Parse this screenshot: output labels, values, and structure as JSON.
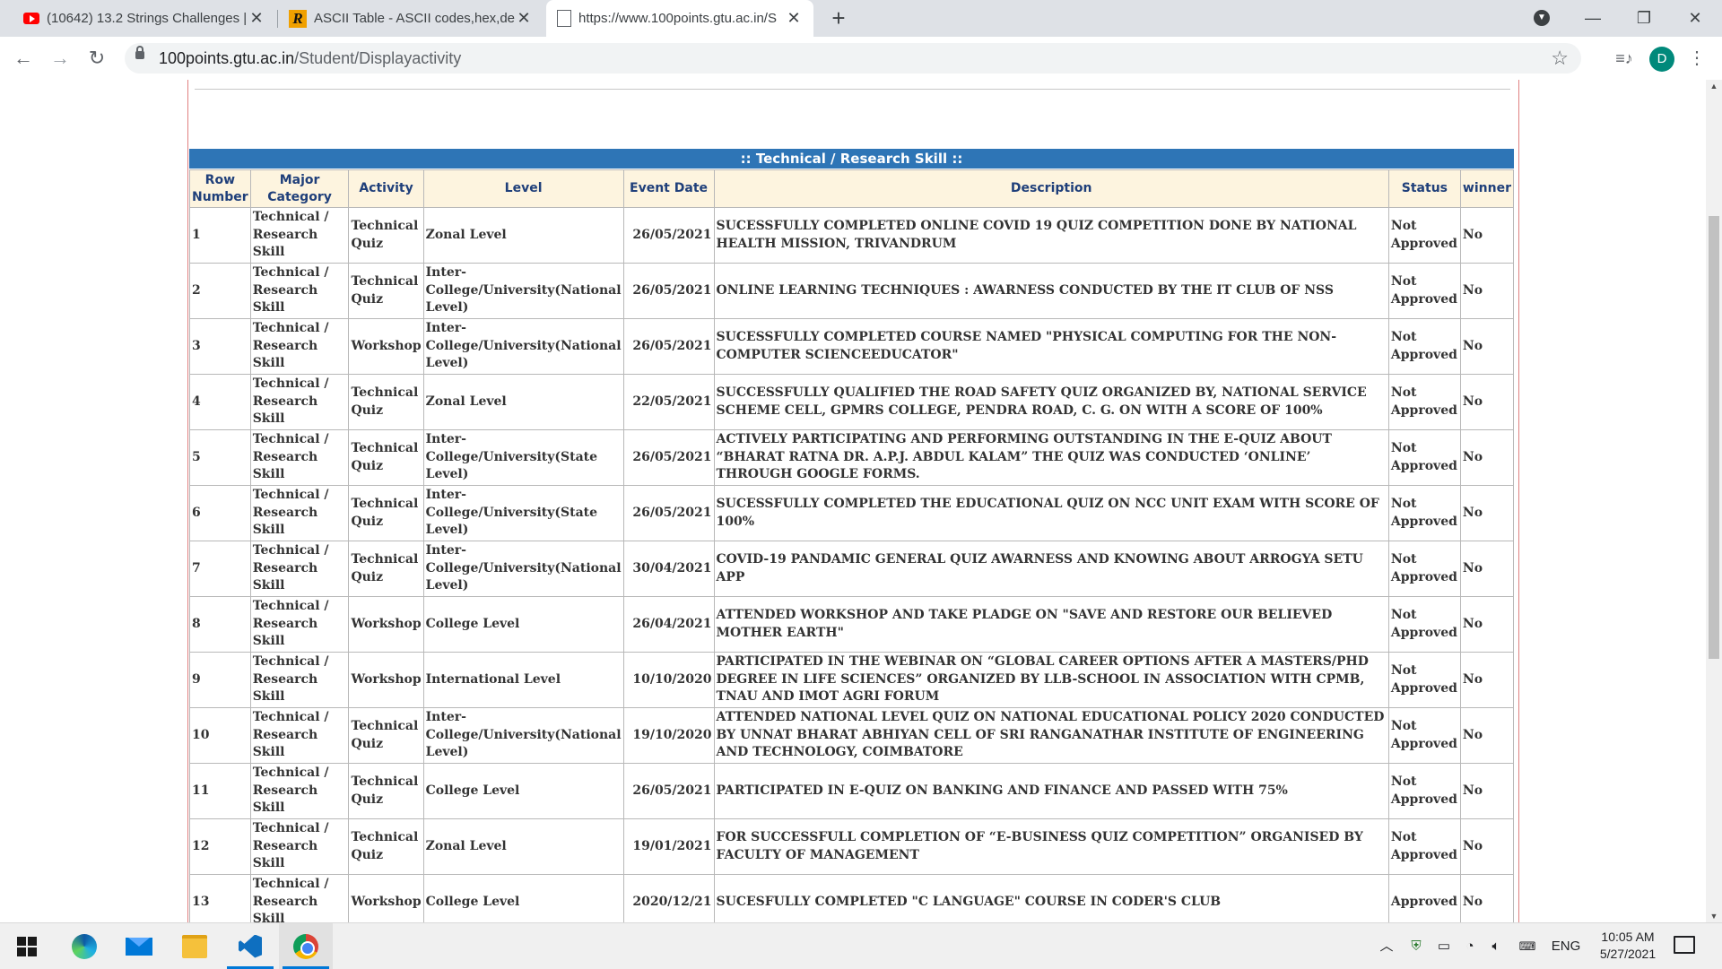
{
  "browser": {
    "tabs": [
      {
        "title": "(10642) 13.2 Strings Challenges |",
        "favicon": "youtube-icon"
      },
      {
        "title": "ASCII Table - ASCII codes,hex,dec",
        "favicon": "r-logo-icon"
      },
      {
        "title": "https://www.100points.gtu.ac.in/S",
        "favicon": "document-icon"
      }
    ],
    "url_domain": "100points.gtu.ac.in",
    "url_path": "/Student/Displayactivity",
    "profile_initial": "D"
  },
  "page": {
    "section_title": ":: Technical / Research Skill ::",
    "columns": [
      "Row Number",
      "Major Category",
      "Activity",
      "Level",
      "Event Date",
      "Description",
      "Status",
      "winner"
    ],
    "rows": [
      {
        "no": "1",
        "category": "Technical / Research Skill",
        "activity": "Technical Quiz",
        "level": "Zonal Level",
        "date": "26/05/2021",
        "description": "SUCESSFULLY COMPLETED ONLINE COVID 19 QUIZ COMPETITION DONE BY NATIONAL HEALTH MISSION, TRIVANDRUM",
        "status": "Not Approved",
        "winner": "No"
      },
      {
        "no": "2",
        "category": "Technical / Research Skill",
        "activity": "Technical Quiz",
        "level": "Inter-College/University(National Level)",
        "date": "26/05/2021",
        "description": "ONLINE LEARNING TECHNIQUES : AWARNESS CONDUCTED BY THE IT CLUB OF NSS",
        "status": "Not Approved",
        "winner": "No"
      },
      {
        "no": "3",
        "category": "Technical / Research Skill",
        "activity": "Workshop",
        "level": "Inter-College/University(National Level)",
        "date": "26/05/2021",
        "description": "SUCESSFULLY COMPLETED COURSE NAMED \"PHYSICAL COMPUTING FOR THE NON-COMPUTER SCIENCEEDUCATOR\"",
        "status": "Not Approved",
        "winner": "No"
      },
      {
        "no": "4",
        "category": "Technical / Research Skill",
        "activity": "Technical Quiz",
        "level": "Zonal Level",
        "date": "22/05/2021",
        "description": "SUCCESSFULLY QUALIFIED THE ROAD SAFETY QUIZ ORGANIZED BY, NATIONAL SERVICE SCHEME CELL, GPMRS COLLEGE, PENDRA ROAD, C. G. ON WITH A SCORE OF 100%",
        "status": "Not Approved",
        "winner": "No"
      },
      {
        "no": "5",
        "category": "Technical / Research Skill",
        "activity": "Technical Quiz",
        "level": "Inter-College/University(State Level)",
        "date": "26/05/2021",
        "description": "ACTIVELY PARTICIPATING AND PERFORMING OUTSTANDING IN THE E-QUIZ ABOUT “BHARAT RATNA DR. A.P.J. ABDUL KALAM” THE QUIZ WAS CONDUCTED ‘ONLINE’ THROUGH GOOGLE FORMS.",
        "status": "Not Approved",
        "winner": "No"
      },
      {
        "no": "6",
        "category": "Technical / Research Skill",
        "activity": "Technical Quiz",
        "level": "Inter-College/University(State Level)",
        "date": "26/05/2021",
        "description": "SUCESSFULLY COMPLETED THE EDUCATIONAL QUIZ ON NCC UNIT EXAM WITH SCORE OF 100%",
        "status": "Not Approved",
        "winner": "No"
      },
      {
        "no": "7",
        "category": "Technical / Research Skill",
        "activity": "Technical Quiz",
        "level": "Inter-College/University(National Level)",
        "date": "30/04/2021",
        "description": "COVID-19 PANDAMIC GENERAL QUIZ AWARNESS AND KNOWING ABOUT ARROGYA SETU APP",
        "status": "Not Approved",
        "winner": "No"
      },
      {
        "no": "8",
        "category": "Technical / Research Skill",
        "activity": "Workshop",
        "level": "College Level",
        "date": "26/04/2021",
        "description": "ATTENDED WORKSHOP AND TAKE PLADGE ON \"SAVE AND RESTORE OUR BELIEVED MOTHER EARTH\"",
        "status": "Not Approved",
        "winner": "No"
      },
      {
        "no": "9",
        "category": "Technical / Research Skill",
        "activity": "Workshop",
        "level": "International Level",
        "date": "10/10/2020",
        "description": "PARTICIPATED IN THE WEBINAR ON “GLOBAL CAREER OPTIONS AFTER A MASTERS/PHD DEGREE IN LIFE SCIENCES” ORGANIZED BY LLB-SCHOOL IN ASSOCIATION WITH CPMB, TNAU AND IMOT AGRI FORUM",
        "status": "Not Approved",
        "winner": "No"
      },
      {
        "no": "10",
        "category": "Technical / Research Skill",
        "activity": "Technical Quiz",
        "level": "Inter-College/University(National Level)",
        "date": "19/10/2020",
        "description": "ATTENDED NATIONAL LEVEL QUIZ ON NATIONAL EDUCATIONAL POLICY 2020 CONDUCTED BY UNNAT BHARAT ABHIYAN CELL OF SRI RANGANATHAR INSTITUTE OF ENGINEERING AND TECHNOLOGY, COIMBATORE",
        "status": "Not Approved",
        "winner": "No"
      },
      {
        "no": "11",
        "category": "Technical / Research Skill",
        "activity": "Technical Quiz",
        "level": "College Level",
        "date": "26/05/2021",
        "description": "PARTICIPATED IN E-QUIZ ON BANKING AND FINANCE AND PASSED WITH 75%",
        "status": "Not Approved",
        "winner": "No"
      },
      {
        "no": "12",
        "category": "Technical / Research Skill",
        "activity": "Technical Quiz",
        "level": "Zonal Level",
        "date": "19/01/2021",
        "description": "FOR SUCCESSFULL COMPLETION OF “E-BUSINESS QUIZ COMPETITION” ORGANISED BY FACULTY OF MANAGEMENT",
        "status": "Not Approved",
        "winner": "No"
      },
      {
        "no": "13",
        "category": "Technical / Research Skill",
        "activity": "Workshop",
        "level": "College Level",
        "date": "2020/12/21",
        "description": "SUCESFULLY COMPLETED \"C LANGUAGE\" COURSE IN CODER'S CLUB",
        "status": "Approved",
        "winner": "No"
      }
    ]
  },
  "taskbar": {
    "language": "ENG",
    "time": "10:05 AM",
    "date": "5/27/2021"
  },
  "colors": {
    "section_header_bg": "#2e75b6",
    "table_header_bg": "#fdf4df",
    "table_header_text": "#1f3f7a"
  }
}
